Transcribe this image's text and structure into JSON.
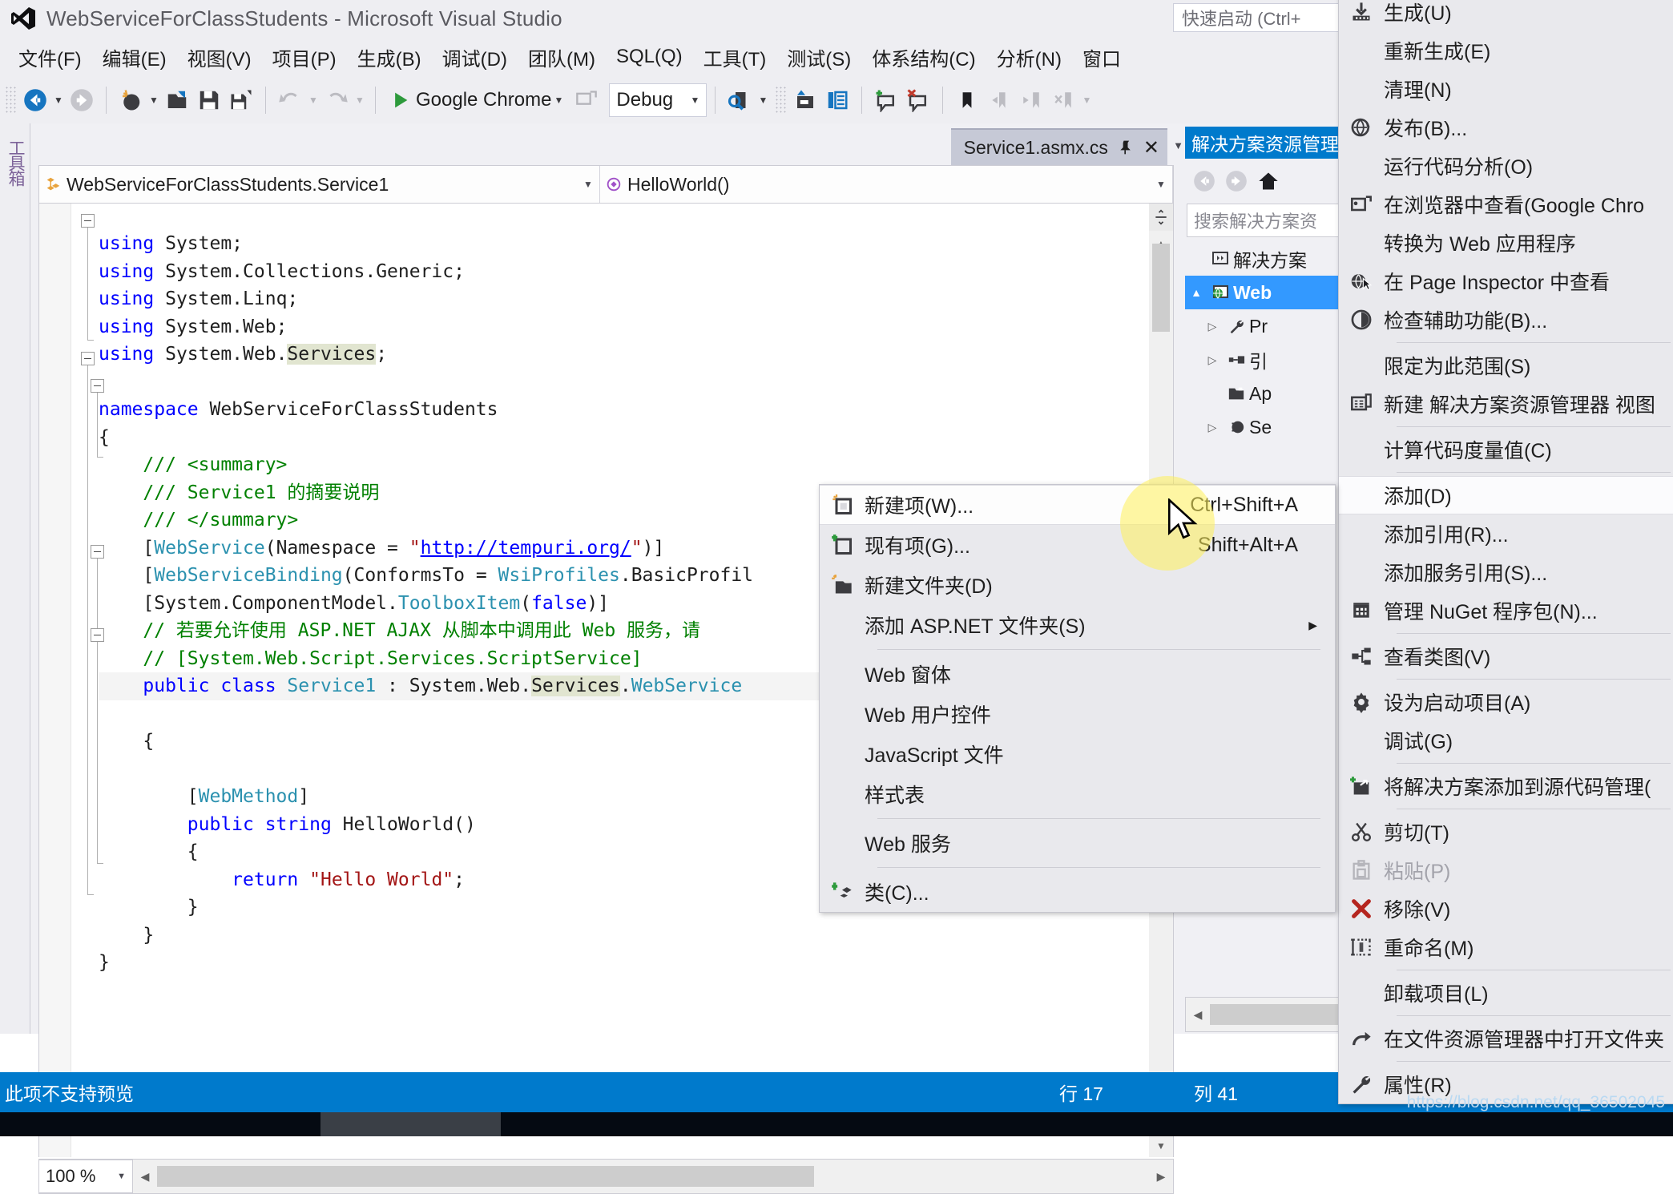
{
  "window": {
    "title": "WebServiceForClassStudents - Microsoft Visual Studio",
    "logo_icon": "visual-studio-logo"
  },
  "quick_launch": {
    "placeholder": "快速启动 (Ctrl+"
  },
  "menubar": {
    "items": [
      {
        "label": "文件(F)"
      },
      {
        "label": "编辑(E)"
      },
      {
        "label": "视图(V)"
      },
      {
        "label": "项目(P)"
      },
      {
        "label": "生成(B)"
      },
      {
        "label": "调试(D)"
      },
      {
        "label": "团队(M)"
      },
      {
        "label": "SQL(Q)"
      },
      {
        "label": "工具(T)"
      },
      {
        "label": "测试(S)"
      },
      {
        "label": "体系结构(C)"
      },
      {
        "label": "分析(N)"
      },
      {
        "label": "窗口"
      }
    ]
  },
  "toolbar": {
    "run_label": "Google Chrome",
    "config_value": "Debug",
    "icons": [
      "navigate-back-icon",
      "navigate-forward-icon",
      "new-project-icon",
      "open-file-icon",
      "save-icon",
      "save-all-icon",
      "undo-icon",
      "redo-icon",
      "start-debug-icon",
      "browse-with-icon",
      "find-icon",
      "solution-explorer-icon",
      "properties-window-icon",
      "comment-icon",
      "uncomment-icon",
      "bookmark-icon",
      "prev-bookmark-icon",
      "next-bookmark-icon",
      "clear-bookmarks-icon"
    ]
  },
  "left_dock": {
    "toolbox_tab": "工具箱"
  },
  "editor": {
    "tab": {
      "name": "Service1.asmx.cs",
      "pin_icon": "pin-icon",
      "close_icon": "close-icon"
    },
    "nav": {
      "type_icon": "class-icon",
      "type": "WebServiceForClassStudents.Service1",
      "member_icon": "method-icon",
      "member": "HelloWorld()"
    },
    "zoom": "100 %",
    "code_lines": [
      "using System;",
      "using System.Collections.Generic;",
      "using System.Linq;",
      "using System.Web;",
      "using System.Web.Services;",
      "",
      "namespace WebServiceForClassStudents",
      "{",
      "    /// <summary>",
      "    /// Service1 的摘要说明",
      "    /// </summary>",
      "    [WebService(Namespace = \"http://tempuri.org/\")]",
      "    [WebServiceBinding(ConformsTo = WsiProfiles.BasicProfil",
      "    [System.ComponentModel.ToolboxItem(false)]",
      "    // 若要允许使用 ASP.NET AJAX 从脚本中调用此 Web 服务，请",
      "    // [System.Web.Script.Services.ScriptService]",
      "    public class Service1 : System.Web.Services.WebService",
      "    {",
      "",
      "        [WebMethod]",
      "        public string HelloWorld()",
      "        {",
      "            return \"Hello World\";",
      "        }",
      "    }",
      "}"
    ]
  },
  "solution_explorer": {
    "title": "解决方案资源管理器",
    "search_placeholder": "搜索解决方案资",
    "nav_icons": [
      "back-icon",
      "forward-icon",
      "home-icon"
    ],
    "tree": [
      {
        "label": "解决方案",
        "icon": "solution-icon",
        "expander": "",
        "selected": false
      },
      {
        "label": "Web",
        "icon": "web-project-icon",
        "expander": "▲",
        "selected": true
      },
      {
        "label": "Pr",
        "icon": "properties-icon",
        "expander": "▷",
        "selected": false
      },
      {
        "label": "引",
        "icon": "references-icon",
        "expander": "▷",
        "selected": false
      },
      {
        "label": "Ap",
        "icon": "folder-icon",
        "expander": "",
        "selected": false
      },
      {
        "label": "Se",
        "icon": "service-icon",
        "expander": "▷",
        "selected": false
      }
    ]
  },
  "context_menu": {
    "items": [
      {
        "label": "新建项(W)...",
        "shortcut": "Ctrl+Shift+A",
        "icon": "new-item-icon",
        "active": true,
        "sep_after": false
      },
      {
        "label": "现有项(G)...",
        "shortcut": "Shift+Alt+A",
        "icon": "existing-item-icon",
        "active": false,
        "sep_after": false
      },
      {
        "label": "新建文件夹(D)",
        "shortcut": "",
        "icon": "new-folder-icon",
        "active": false,
        "sep_after": false
      },
      {
        "label": "添加 ASP.NET 文件夹(S)",
        "shortcut": "",
        "icon": "",
        "active": false,
        "submenu": true,
        "sep_after": true
      },
      {
        "label": "Web 窗体",
        "shortcut": "",
        "icon": "",
        "active": false,
        "sep_after": false
      },
      {
        "label": "Web 用户控件",
        "shortcut": "",
        "icon": "",
        "active": false,
        "sep_after": false
      },
      {
        "label": "JavaScript 文件",
        "shortcut": "",
        "icon": "",
        "active": false,
        "sep_after": false
      },
      {
        "label": "样式表",
        "shortcut": "",
        "icon": "",
        "active": false,
        "sep_after": true
      },
      {
        "label": "Web 服务",
        "shortcut": "",
        "icon": "",
        "active": false,
        "sep_after": true
      },
      {
        "label": "类(C)...",
        "shortcut": "",
        "icon": "new-class-icon",
        "active": false,
        "sep_after": false
      }
    ]
  },
  "project_menu": {
    "items": [
      {
        "label": "生成(U)",
        "icon": "build-icon",
        "disabled": false,
        "active": false,
        "sep_after": false
      },
      {
        "label": "重新生成(E)",
        "icon": "",
        "disabled": false,
        "active": false,
        "sep_after": false
      },
      {
        "label": "清理(N)",
        "icon": "",
        "disabled": false,
        "active": false,
        "sep_after": false
      },
      {
        "label": "发布(B)...",
        "icon": "publish-icon",
        "disabled": false,
        "active": false,
        "sep_after": false
      },
      {
        "label": "运行代码分析(O)",
        "icon": "",
        "disabled": false,
        "active": false,
        "sep_after": false
      },
      {
        "label": "在浏览器中查看(Google Chro",
        "icon": "view-in-browser-icon",
        "disabled": false,
        "active": false,
        "sep_after": false
      },
      {
        "label": "转换为 Web 应用程序",
        "icon": "",
        "disabled": false,
        "active": false,
        "sep_after": false
      },
      {
        "label": "在 Page Inspector 中查看",
        "icon": "page-inspector-icon",
        "disabled": false,
        "active": false,
        "sep_after": false
      },
      {
        "label": "检查辅助功能(B)...",
        "icon": "accessibility-icon",
        "disabled": false,
        "active": false,
        "sep_after": true
      },
      {
        "label": "限定为此范围(S)",
        "icon": "",
        "disabled": false,
        "active": false,
        "sep_after": false
      },
      {
        "label": "新建 解决方案资源管理器 视图",
        "icon": "new-solution-view-icon",
        "disabled": false,
        "active": false,
        "sep_after": true
      },
      {
        "label": "计算代码度量值(C)",
        "icon": "",
        "disabled": false,
        "active": false,
        "sep_after": true
      },
      {
        "label": "添加(D)",
        "icon": "",
        "disabled": false,
        "active": true,
        "sep_after": false
      },
      {
        "label": "添加引用(R)...",
        "icon": "",
        "disabled": false,
        "active": false,
        "sep_after": false
      },
      {
        "label": "添加服务引用(S)...",
        "icon": "",
        "disabled": false,
        "active": false,
        "sep_after": false
      },
      {
        "label": "管理 NuGet 程序包(N)...",
        "icon": "nuget-icon",
        "disabled": false,
        "active": false,
        "sep_after": true
      },
      {
        "label": "查看类图(V)",
        "icon": "class-diagram-icon",
        "disabled": false,
        "active": false,
        "sep_after": true
      },
      {
        "label": "设为启动项目(A)",
        "icon": "startup-project-icon",
        "disabled": false,
        "active": false,
        "sep_after": false
      },
      {
        "label": "调试(G)",
        "icon": "",
        "disabled": false,
        "active": false,
        "sep_after": true
      },
      {
        "label": "将解决方案添加到源代码管理(",
        "icon": "source-control-icon",
        "disabled": false,
        "active": false,
        "sep_after": true
      },
      {
        "label": "剪切(T)",
        "icon": "cut-icon",
        "disabled": false,
        "active": false,
        "sep_after": false
      },
      {
        "label": "粘贴(P)",
        "icon": "paste-icon",
        "disabled": true,
        "active": false,
        "sep_after": false
      },
      {
        "label": "移除(V)",
        "icon": "remove-icon",
        "disabled": false,
        "active": false,
        "sep_after": false
      },
      {
        "label": "重命名(M)",
        "icon": "rename-icon",
        "disabled": false,
        "active": false,
        "sep_after": true
      },
      {
        "label": "卸载项目(L)",
        "icon": "",
        "disabled": false,
        "active": false,
        "sep_after": true
      },
      {
        "label": "在文件资源管理器中打开文件夹",
        "icon": "open-folder-icon",
        "disabled": false,
        "active": false,
        "sep_after": true
      },
      {
        "label": "属性(R)",
        "icon": "properties-wrench-icon",
        "disabled": false,
        "active": false,
        "sep_after": false
      }
    ]
  },
  "statusbar": {
    "message": "此项不支持预览",
    "line": "行 17",
    "column": "列 41"
  },
  "watermark": "https://blog.csdn.net/qq_36502045",
  "colors": {
    "accent": "#007acc",
    "selection": "#3399ff",
    "menu_bg": "#e9e9ed",
    "chrome_bg": "#eeeef2"
  }
}
